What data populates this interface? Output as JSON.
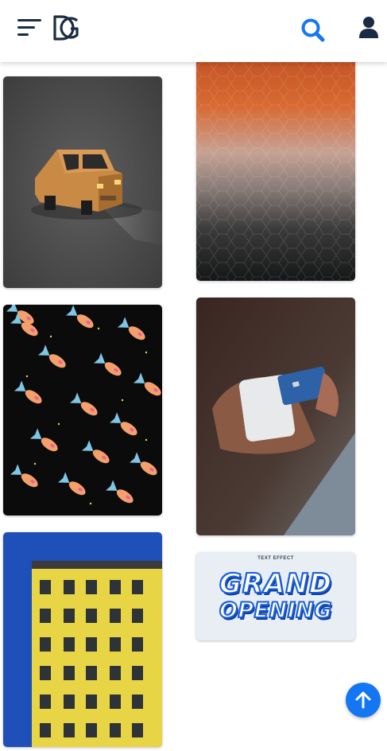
{
  "header": {
    "menu_icon": "hamburger-menu-icon",
    "logo_icon": "dg-logo",
    "search_icon": "search-icon",
    "user_icon": "user-icon",
    "brand_color": "#1476f2",
    "icon_color": "#1a2b44"
  },
  "gallery": {
    "items": [
      {
        "name": "lowpoly-car-image",
        "icon": "image-thumbnail"
      },
      {
        "name": "textured-glass-sunset-image",
        "icon": "image-thumbnail"
      },
      {
        "name": "goldfish-pattern-image",
        "icon": "image-thumbnail"
      },
      {
        "name": "card-payment-terminal-image",
        "icon": "image-thumbnail"
      },
      {
        "name": "yellow-building-image",
        "icon": "image-thumbnail"
      },
      {
        "name": "grand-opening-text-effect-image",
        "icon": "image-thumbnail"
      }
    ],
    "grand_opening": {
      "top_label": "TEXT EFFECT",
      "line1": "GRAND",
      "line2": "OPENING"
    }
  },
  "scroll_top": {
    "icon": "arrow-up-icon",
    "color": "#1476f2"
  }
}
